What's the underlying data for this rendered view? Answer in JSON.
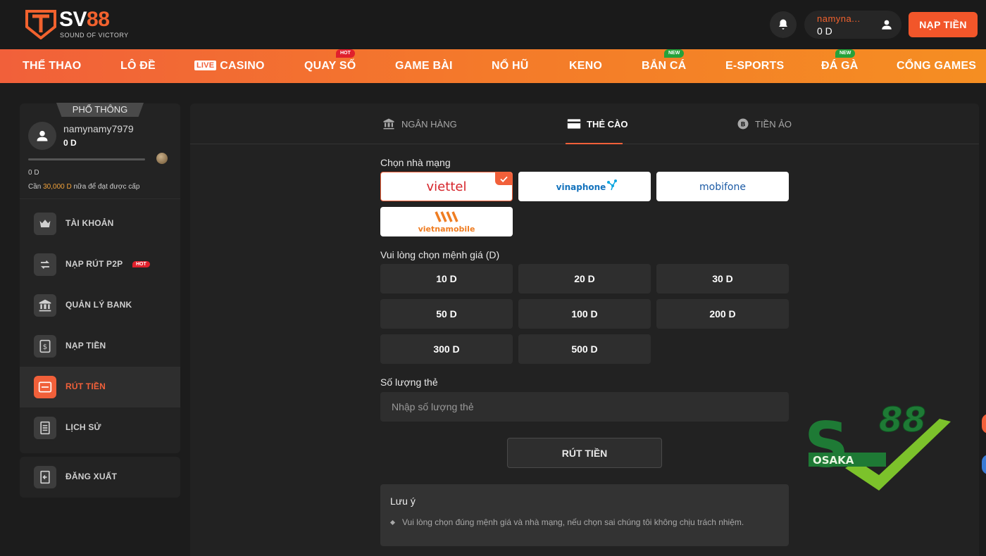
{
  "brand": {
    "name_prefix": "SV",
    "name_suffix": "88",
    "tagline": "SOUND OF VICTORY",
    "accent": "#f1603a"
  },
  "header": {
    "username": "namyna...",
    "balance": "0 D",
    "deposit_label": "NẠP TIỀN"
  },
  "nav": {
    "items": [
      {
        "label": "THỂ THAO"
      },
      {
        "label": "LÔ ĐỀ"
      },
      {
        "label": "CASINO",
        "live": "LIVE"
      },
      {
        "label": "QUAY SỐ",
        "badge": "HOT"
      },
      {
        "label": "GAME BÀI"
      },
      {
        "label": "NỔ HŨ"
      },
      {
        "label": "KENO"
      },
      {
        "label": "BẮN CÁ",
        "badge": "NEW"
      },
      {
        "label": "E-SPORTS"
      },
      {
        "label": "ĐÁ GÀ",
        "badge": "NEW"
      },
      {
        "label": "CỔNG GAMES"
      }
    ]
  },
  "sidebar": {
    "tier": "PHỔ THÔNG",
    "username": "namynamy7979",
    "balance": "0 D",
    "progress_fraction": 0,
    "points": "0 D",
    "level_hint_prefix": "Cần ",
    "level_hint_amount": "30,000 D",
    "level_hint_suffix": " nữa để đạt được cấp",
    "menu": [
      {
        "label": "TÀI KHOẢN",
        "icon": "crown-icon"
      },
      {
        "label": "NẠP RÚT P2P",
        "icon": "transfer-icon",
        "badge": "HOT"
      },
      {
        "label": "QUẢN LÝ BANK",
        "icon": "bank-icon"
      },
      {
        "label": "NẠP TIỀN",
        "icon": "money-icon"
      },
      {
        "label": "RÚT TIỀN",
        "icon": "wallet-icon",
        "active": true
      },
      {
        "label": "LỊCH SỬ",
        "icon": "history-icon"
      }
    ],
    "logout_label": "ĐĂNG XUẤT"
  },
  "main": {
    "tabs": [
      {
        "label": "NGÂN HÀNG",
        "icon": "bank-icon"
      },
      {
        "label": "THẺ CÀO",
        "icon": "card-icon",
        "active": true
      },
      {
        "label": "TIỀN ẢO",
        "icon": "crypto-icon"
      }
    ],
    "carrier_label": "Chọn nhà mạng",
    "carriers": [
      {
        "name": "viettel",
        "selected": true
      },
      {
        "name": "vinaphone"
      },
      {
        "name": "mobifone"
      },
      {
        "name": "vietnamobile"
      }
    ],
    "amount_label": "Vui lòng chọn mệnh giá (D)",
    "amounts": [
      "10 D",
      "20 D",
      "30 D",
      "50 D",
      "100 D",
      "200 D",
      "300 D",
      "500 D"
    ],
    "quantity_label": "Số lượng thẻ",
    "quantity_placeholder": "Nhập số lượng thẻ",
    "submit_label": "RÚT TIỀN",
    "note_title": "Lưu ý",
    "note_text": "Vui lòng chọn đúng mệnh giá và nhà mạng, nếu chọn sai chúng tôi không chịu trách nhiệm."
  },
  "watermark": {
    "text": "88",
    "sub": "OSAKA"
  }
}
